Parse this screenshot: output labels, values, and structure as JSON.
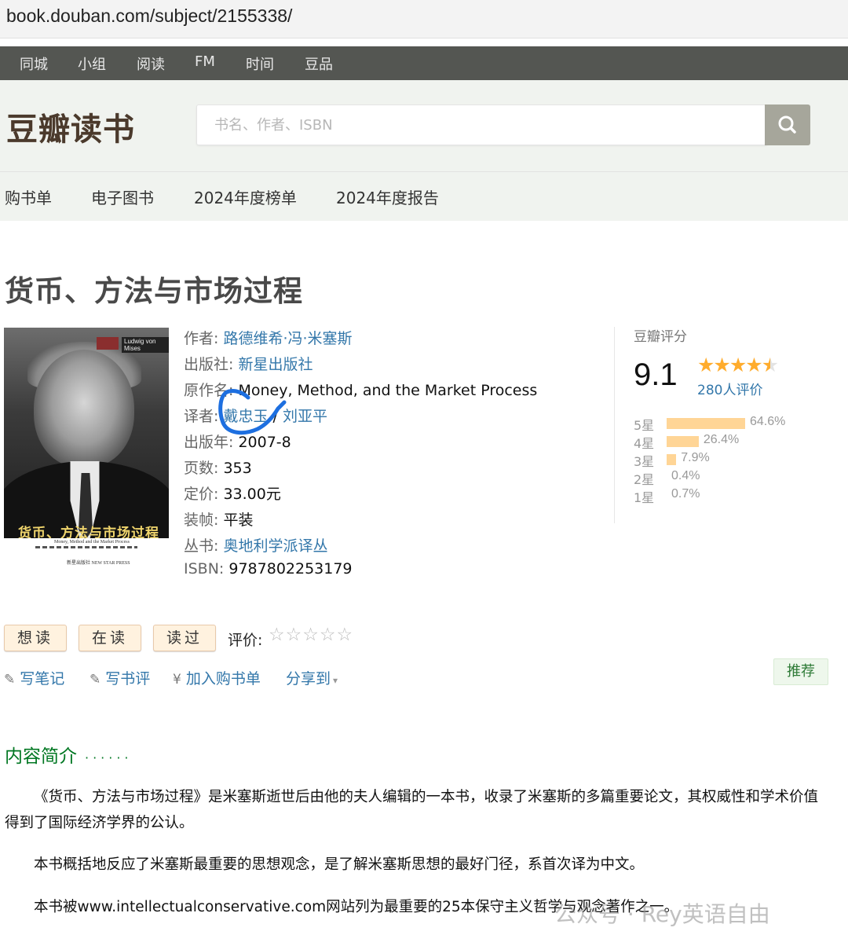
{
  "browser": {
    "url": "book.douban.com/subject/2155338/"
  },
  "global_nav": [
    "同城",
    "小组",
    "阅读",
    "FM",
    "时间",
    "豆品"
  ],
  "header": {
    "logo": "豆瓣读书",
    "search_placeholder": "书名、作者、ISBN"
  },
  "sub_nav": [
    "购书单",
    "电子图书",
    "2024年度榜单",
    "2024年度报告"
  ],
  "book": {
    "title": "货币、方法与市场过程",
    "cover_title": "货币、方法与市场过程",
    "cover_author_tag": "Ludwig von Mises",
    "cover_subtitle": "Money, Method and the Market Process",
    "cover_publisher": "新星出版社 NEW STAR PRESS",
    "info": {
      "author_label": "作者:",
      "author": "路德维希·冯·米塞斯",
      "publisher_label": "出版社:",
      "publisher": "新星出版社",
      "original_label": "原作名:",
      "original": "Money, Method, and the Market Process",
      "translator_label": "译者:",
      "translator1": "戴忠玉",
      "translator_sep": " / ",
      "translator2": "刘亚平",
      "year_label": "出版年:",
      "year": "2007-8",
      "pages_label": "页数:",
      "pages": "353",
      "price_label": "定价:",
      "price": "33.00元",
      "binding_label": "装帧:",
      "binding": "平装",
      "series_label": "丛书:",
      "series": "奥地利学派译丛",
      "isbn_label": "ISBN:",
      "isbn": "9787802253179"
    }
  },
  "rating": {
    "label": "豆瓣评分",
    "score": "9.1",
    "stars_value": 4.5,
    "count": "280人评价",
    "breakdown": [
      {
        "star": "5星",
        "pct": "64.6%",
        "value": 64.6
      },
      {
        "star": "4星",
        "pct": "26.4%",
        "value": 26.4
      },
      {
        "star": "3星",
        "pct": "7.9%",
        "value": 7.9
      },
      {
        "star": "2星",
        "pct": "0.4%",
        "value": 0.4
      },
      {
        "star": "1星",
        "pct": "0.7%",
        "value": 0.7
      }
    ]
  },
  "actions": {
    "want": "想读",
    "reading": "在读",
    "read": "读过",
    "rate_label": "评价:",
    "write_note": "写笔记",
    "write_review": "写书评",
    "add_cart": "加入购书单",
    "share": "分享到",
    "recommend": "推荐"
  },
  "intro": {
    "title": "内容简介",
    "dots": "······",
    "p1": "《货币、方法与市场过程》是米塞斯逝世后由他的夫人编辑的一本书，收录了米塞斯的多篇重要论文，其权威性和学术价值得到了国际经济学界的公认。",
    "p2": "本书概括地反应了米塞斯最重要的思想观念，是了解米塞斯思想的最好门径，系首次译为中文。",
    "p3": "本书被www.intellectualconservative.com网站列为最重要的25本保守主义哲学与观念著作之一。"
  },
  "watermark": "公众号 · Rey英语自由",
  "colors": {
    "link": "#3377aa",
    "nav_bg": "#545652",
    "star": "#ffac2d",
    "bar": "#ffd596",
    "intro_green": "#007722"
  }
}
